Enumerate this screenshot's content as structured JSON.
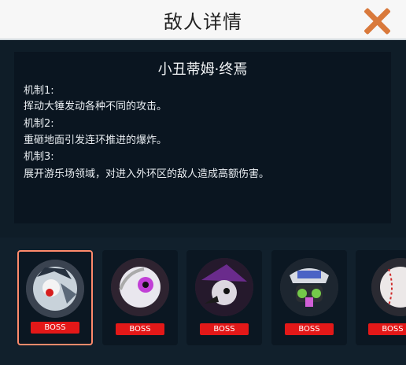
{
  "header": {
    "title": "敌人详情"
  },
  "enemy": {
    "name": "小丑蒂姆·终焉",
    "mechanics": [
      {
        "label": "机制1:",
        "desc": "挥动大锤发动各种不同的攻击。"
      },
      {
        "label": "机制2:",
        "desc": "重砸地面引发连环推进的爆炸。"
      },
      {
        "label": "机制3:",
        "desc": "展开游乐场领域，对进入外环区的敌人造成高额伤害。"
      }
    ]
  },
  "cards": [
    {
      "badge": "BOSS",
      "icon": "clown-boss-portrait",
      "selected": true
    },
    {
      "badge": "BOSS",
      "icon": "pink-eye-boss-portrait",
      "selected": false
    },
    {
      "badge": "BOSS",
      "icon": "witch-plague-boss-portrait",
      "selected": false
    },
    {
      "badge": "BOSS",
      "icon": "shield-gasmask-boss-portrait",
      "selected": false
    },
    {
      "badge": "BOSS",
      "icon": "stitched-ball-boss-portrait",
      "selected": false
    }
  ],
  "colors": {
    "accent": "#d9793b",
    "badge": "#e31818",
    "selection": "#ff8a6b"
  }
}
